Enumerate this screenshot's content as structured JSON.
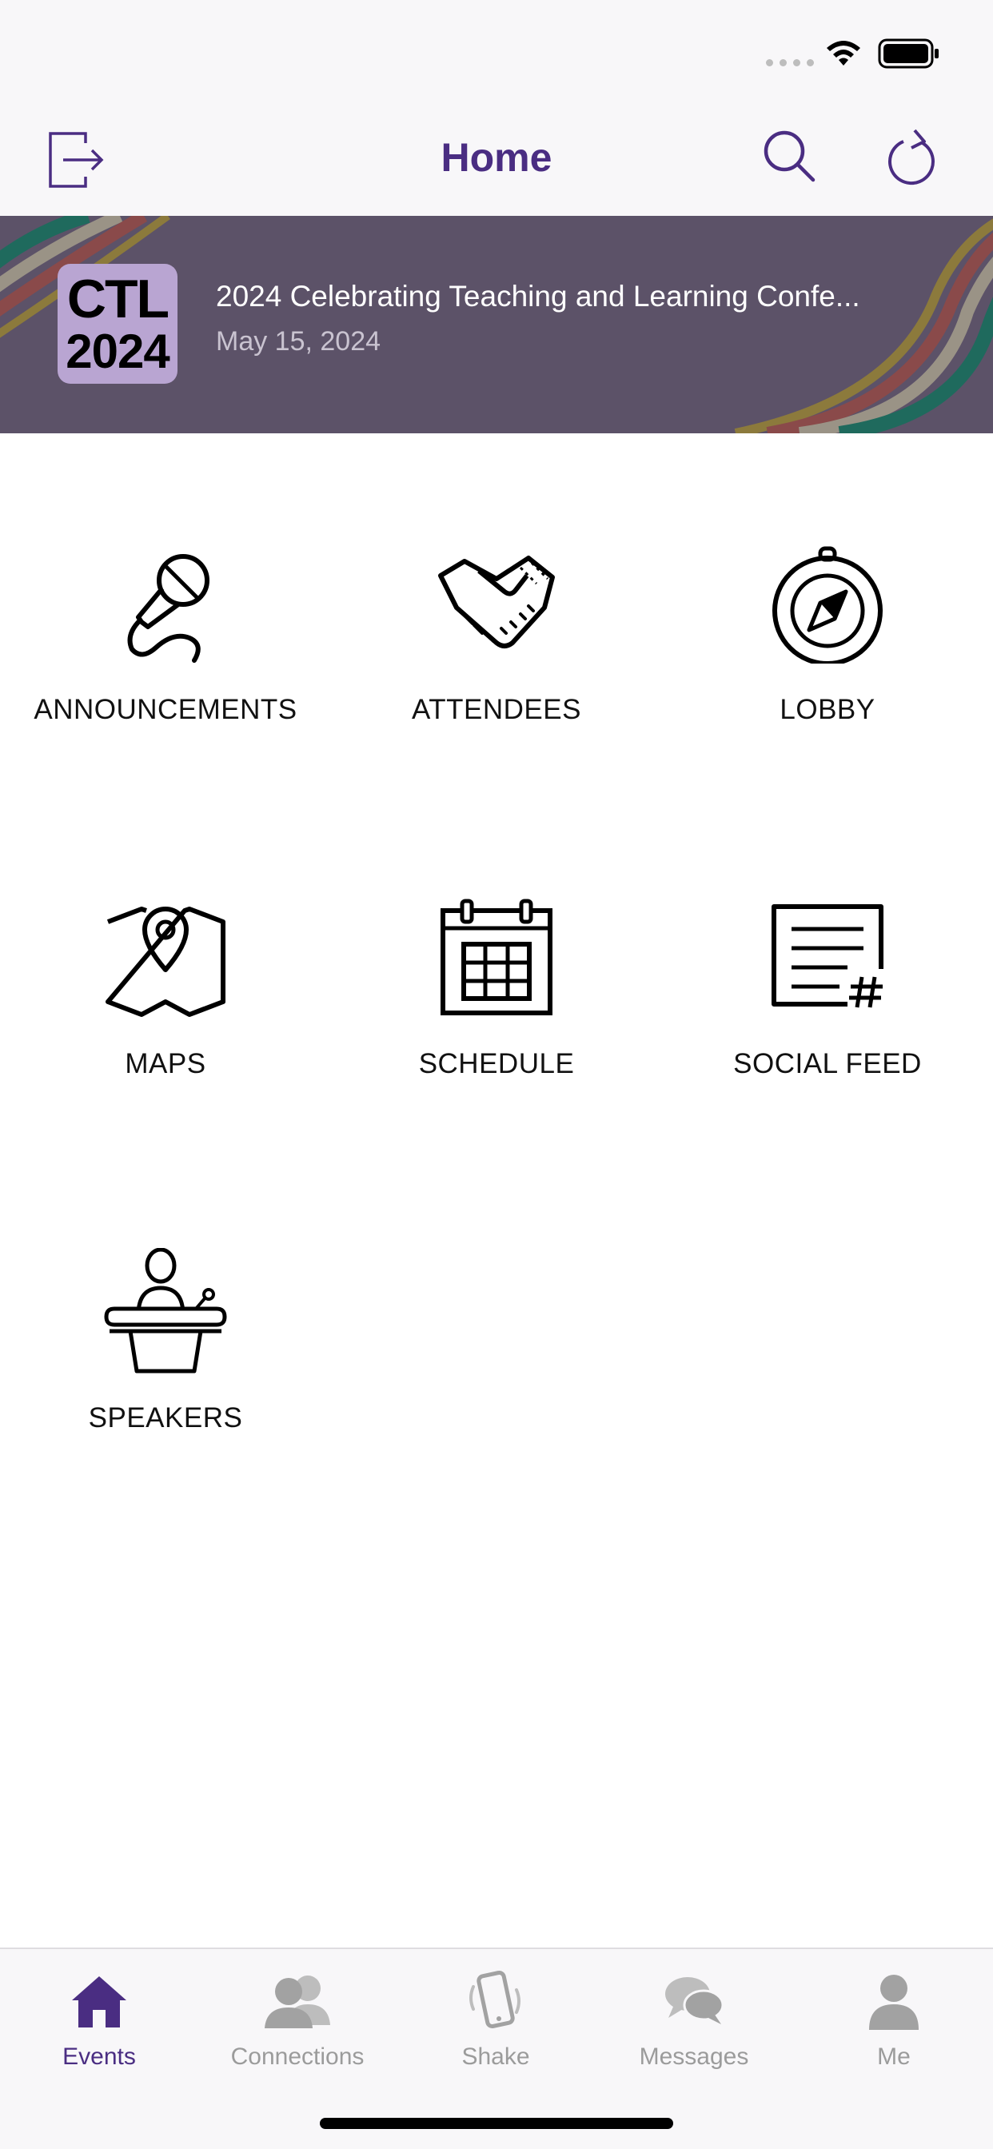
{
  "nav": {
    "title": "Home"
  },
  "event": {
    "logo_line1": "CTL",
    "logo_line2": "2024",
    "title": "2024 Celebrating Teaching and Learning Confe...",
    "date": "May 15, 2024"
  },
  "tiles": [
    {
      "label": "ANNOUNCEMENTS",
      "icon": "microphone-icon"
    },
    {
      "label": "ATTENDEES",
      "icon": "handshake-icon"
    },
    {
      "label": "LOBBY",
      "icon": "compass-icon"
    },
    {
      "label": "MAPS",
      "icon": "map-pin-icon"
    },
    {
      "label": "SCHEDULE",
      "icon": "calendar-icon"
    },
    {
      "label": "SOCIAL FEED",
      "icon": "social-feed-icon"
    },
    {
      "label": "SPEAKERS",
      "icon": "podium-icon"
    }
  ],
  "tabs": [
    {
      "label": "Events",
      "icon": "house-icon",
      "active": true
    },
    {
      "label": "Connections",
      "icon": "people-icon",
      "active": false
    },
    {
      "label": "Shake",
      "icon": "phone-shake-icon",
      "active": false
    },
    {
      "label": "Messages",
      "icon": "chat-bubbles-icon",
      "active": false
    },
    {
      "label": "Me",
      "icon": "person-icon",
      "active": false
    }
  ],
  "colors": {
    "accent": "#4a2d82",
    "banner_bg": "#5c5268",
    "tab_inactive": "#9b9b9b"
  }
}
